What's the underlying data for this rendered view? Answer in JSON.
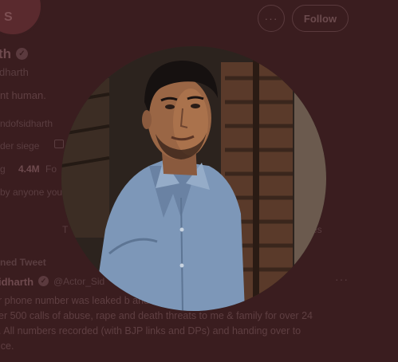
{
  "profile": {
    "name_fragment": "th",
    "handle_fragment": "dharth",
    "bio_fragment": "nt human.",
    "link_fragment": "ndofsidharth",
    "location_fragment": "der siege",
    "following_fragment": "g",
    "followers_count": "4.4M",
    "followers_label": "Fo",
    "followed_fragment": "by anyone you"
  },
  "actions": {
    "more_label": "···",
    "follow_label": "Follow"
  },
  "tabs": {
    "left_fragment": "T",
    "right_fragment": "es"
  },
  "tweet": {
    "pinned_label": "ned Tweet",
    "name": "idharth",
    "handle": "@Actor_Sid",
    "more_label": "···",
    "lines": [
      "r phone number was leaked b                                   and @BJP4TamilNadu",
      "er 500 calls of abuse, rape and death threats to me & family for over 24",
      ". All numbers recorded (with BJP links and DPs) and handing over to",
      "ice."
    ]
  },
  "header": {
    "avatar_glyph": "S"
  },
  "colors": {
    "overlay_bg": "#3a1d1f",
    "shirt": "#7d97b8"
  }
}
